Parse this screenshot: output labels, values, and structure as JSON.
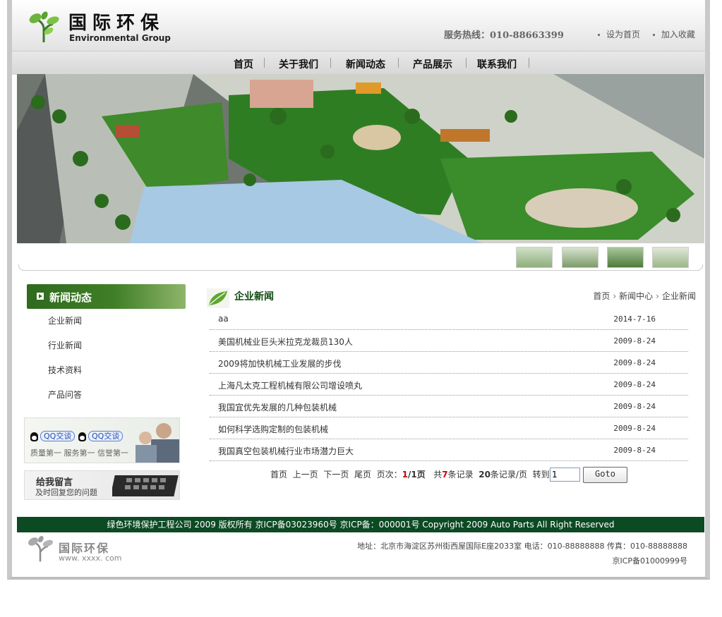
{
  "header": {
    "logo_cn": "国际环保",
    "logo_en": "Environmental Group",
    "hotline": "服务热线：010-88663399",
    "set_home": "设为首页",
    "add_favorite": "加入收藏"
  },
  "nav": {
    "items": [
      "首页",
      "关于我们",
      "新闻动态",
      "产品展示",
      "联系我们"
    ]
  },
  "sidebar": {
    "title": "新闻动态",
    "items": [
      "企业新闻",
      "行业新闻",
      "技术资料",
      "产品问答"
    ],
    "qq_label": "QQ交谈",
    "qq_quality": "质量第一  服务第一  信誉第一",
    "message_title": "给我留言",
    "message_sub": "及时回复您的问题"
  },
  "content": {
    "title": "企业新闻",
    "breadcrumb": [
      "首页",
      "新闻中心",
      "企业新闻"
    ],
    "news": [
      {
        "title": "aa",
        "date": "2014-7-16"
      },
      {
        "title": "美国机械业巨头米拉克龙裁员130人",
        "date": "2009-8-24"
      },
      {
        "title": "2009将加快机械工业发展的步伐",
        "date": "2009-8-24"
      },
      {
        "title": "上海凡太克工程机械有限公司增设喷丸",
        "date": "2009-8-24"
      },
      {
        "title": "我国宜优先发展的几种包装机械",
        "date": "2009-8-24"
      },
      {
        "title": "如何科学选购定制的包装机械",
        "date": "2009-8-24"
      },
      {
        "title": "我国真空包装机械行业市场潜力巨大",
        "date": "2009-8-24"
      }
    ],
    "pager": {
      "first": "首页",
      "prev": "上一页",
      "next": "下一页",
      "last": "尾页",
      "page_label": "页次：",
      "current": "1",
      "total_pages": "/1页",
      "total_prefix": "共",
      "total_records": "7",
      "total_suffix": "条记录",
      "per_page": "20",
      "per_page_suffix": "条记录/页",
      "jump_label": "转到：",
      "input_value": "1",
      "goto": "Goto"
    }
  },
  "footer": {
    "copyright": "绿色环境保护工程公司 2009 版权所有 京ICP备03023960号 京ICP备：000001号 Copyright 2009 Auto Parts All Right Reserved",
    "logo_cn": "国际环保",
    "logo_url": "www. xxxx. com",
    "address": "地址：北京市海淀区苏州街西屋国际E座2033室  电话：010-88888888  传真：010-88888888",
    "icp": "京ICP备01000999号"
  },
  "colors": {
    "brand_green": "#0c4a23",
    "nav_gray": "#dcdcdc",
    "accent_red": "#cc0000"
  }
}
